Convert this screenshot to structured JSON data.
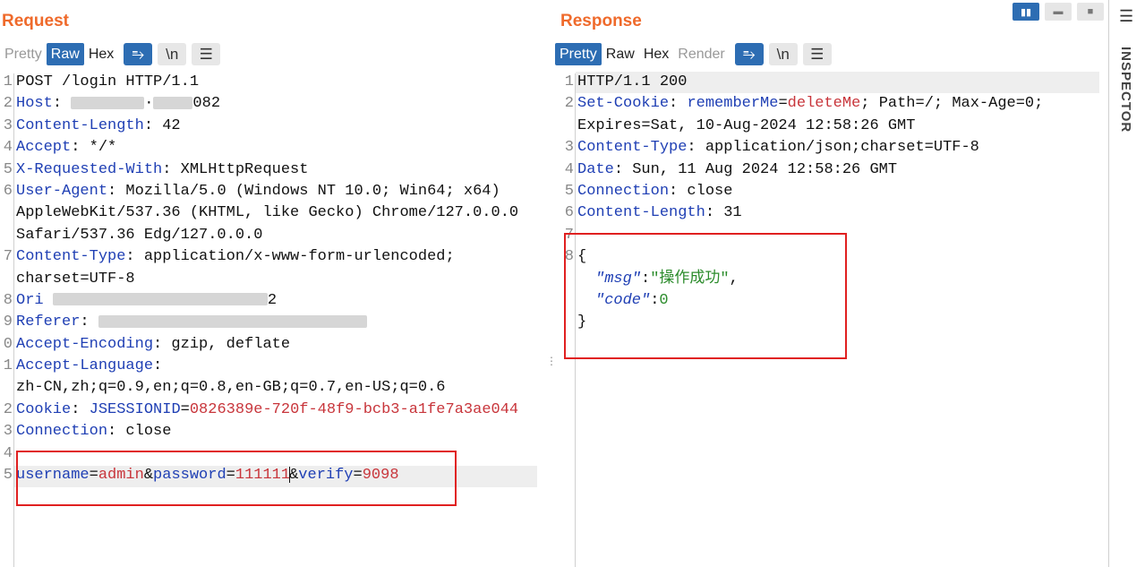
{
  "request": {
    "title": "Request",
    "tabs": [
      "Pretty",
      "Raw",
      "Hex"
    ],
    "active_tab": "Raw",
    "line_numbers": [
      "1",
      "2",
      "3",
      "4",
      "5",
      "6",
      "",
      "",
      "7",
      "",
      "8",
      "9",
      "0",
      "1",
      "",
      "2",
      "3",
      "4",
      "5"
    ],
    "lines": {
      "l1": "POST /login HTTP/1.1",
      "l2_key": "Host",
      "l2_val_visible": "2",
      "l3_key": "Content-Length",
      "l3_val": " 42",
      "l4_key": "Accept",
      "l4_val": " */*",
      "l5_key": "X-Requested-With",
      "l5_val": " XMLHttpRequest",
      "l6_key": "User-Agent",
      "l6_val": " Mozilla/5.0 (Windows NT 10.0; Win64; x64)",
      "l6b": "AppleWebKit/537.36 (KHTML, like Gecko) Chrome/127.0.0.0",
      "l6c": "Safari/537.36 Edg/127.0.0.0",
      "l7_key": "Content-Type",
      "l7_val": " application/x-www-form-urlencoded;",
      "l7b": "charset=UTF-8",
      "l8_key": "Ori",
      "l8_tail": "2",
      "l9_key": "Referer",
      "l10_key": "Accept-Encoding",
      "l10_val": " gzip, deflate",
      "l11_key": "Accept-Language",
      "l11_val": "",
      "l11b": "zh-CN,zh;q=0.9,en;q=0.8,en-GB;q=0.7,en-US;q=0.6",
      "l12_key": "Cookie",
      "l12_ck": "JSESSIONID",
      "l12_cv": "0826389e-720f-48f9-bcb3-a1fe7a3ae044",
      "l13_key": "Connection",
      "l13_val": " close",
      "body_k1": "username",
      "body_v1": "admin",
      "body_k2": "password",
      "body_v2": "111111",
      "body_k3": "verify",
      "body_v3": "9098"
    }
  },
  "response": {
    "title": "Response",
    "tabs": [
      "Pretty",
      "Raw",
      "Hex",
      "Render"
    ],
    "active_tab": "Pretty",
    "lines": {
      "l1": "HTTP/1.1 200",
      "l2_key": "Set-Cookie",
      "l2_ck": "rememberMe",
      "l2_cv": "deleteMe",
      "l2_rest": "; Path=/; Max-Age=0;",
      "l2b": "Expires=Sat, 10-Aug-2024 12:58:26 GMT",
      "l3_key": "Content-Type",
      "l3_val": " application/json;charset=UTF-8",
      "l4_key": "Date",
      "l4_val": " Sun, 11 Aug 2024 12:58:26 GMT",
      "l5_key": "Connection",
      "l5_val": " close",
      "l6_key": "Content-Length",
      "l6_val": " 31",
      "json_open": "{",
      "json_k1": "\"msg\"",
      "json_v1": "\"操作成功\"",
      "json_k2": "\"code\"",
      "json_v2": "0",
      "json_close": "}"
    }
  },
  "toolbar_icons": {
    "wrap": "wrap-icon",
    "newline": "\\n",
    "menu": "menu-icon"
  },
  "inspector": {
    "label": "INSPECTOR"
  },
  "colors": {
    "accent": "#2d6db3",
    "title": "#ef6a2b",
    "key": "#1f3fb4",
    "value": "#c8353b",
    "highlight_box": "#e02020"
  }
}
